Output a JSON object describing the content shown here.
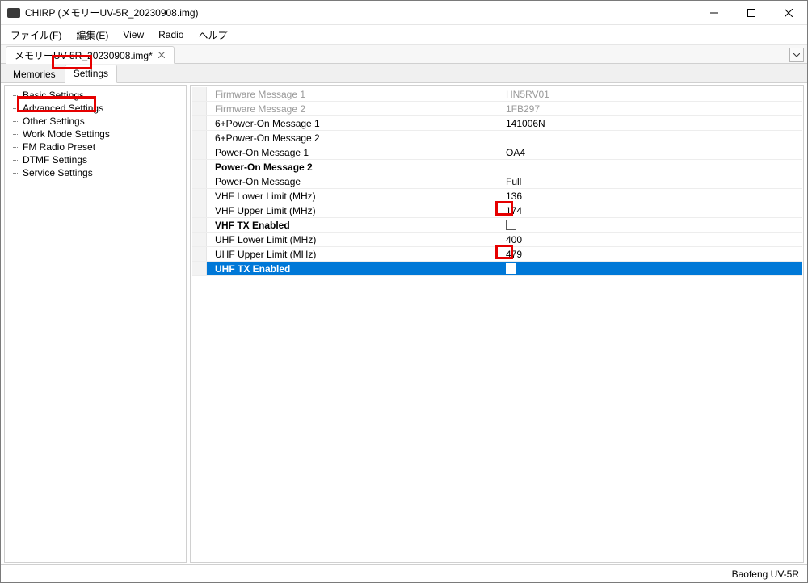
{
  "titlebar": {
    "title": "CHIRP (メモリーUV-5R_20230908.img)"
  },
  "menubar": {
    "file": "ファイル(F)",
    "edit": "編集(E)",
    "view": "View",
    "radio": "Radio",
    "help": "ヘルプ"
  },
  "doc_tab": {
    "label": "メモリーUV-5R_20230908.img*"
  },
  "view_tabs": {
    "memories": "Memories",
    "settings": "Settings"
  },
  "tree": {
    "basic": "Basic Settings",
    "advanced": "Advanced Settings",
    "other": "Other Settings",
    "workmode": "Work Mode Settings",
    "fmradio": "FM Radio Preset",
    "dtmf": "DTMF Settings",
    "service": "Service Settings"
  },
  "settings": {
    "rows": [
      {
        "label": "Firmware Message 1",
        "value": "HN5RV01",
        "type": "text",
        "disabled": true
      },
      {
        "label": "Firmware Message 2",
        "value": "1FB297",
        "type": "text",
        "disabled": true
      },
      {
        "label": "6+Power-On Message 1",
        "value": "141006N",
        "type": "text"
      },
      {
        "label": "6+Power-On Message 2",
        "value": "",
        "type": "text"
      },
      {
        "label": "Power-On Message 1",
        "value": " OA4",
        "type": "text"
      },
      {
        "label": "Power-On Message 2",
        "value": "",
        "type": "text",
        "bold": true
      },
      {
        "label": "Power-On Message",
        "value": "Full",
        "type": "text"
      },
      {
        "label": "VHF Lower Limit (MHz)",
        "value": "136",
        "type": "text"
      },
      {
        "label": "VHF Upper Limit (MHz)",
        "value": "174",
        "type": "text"
      },
      {
        "label": "VHF TX Enabled",
        "value": "",
        "type": "checkbox",
        "bold": true,
        "checked": false
      },
      {
        "label": "UHF Lower Limit (MHz)",
        "value": "400",
        "type": "text"
      },
      {
        "label": "UHF Upper Limit (MHz)",
        "value": "479",
        "type": "text"
      },
      {
        "label": "UHF TX Enabled",
        "value": "",
        "type": "checkbox",
        "bold": true,
        "selected": true,
        "checked": false
      }
    ]
  },
  "statusbar": {
    "device": "Baofeng UV-5R"
  }
}
